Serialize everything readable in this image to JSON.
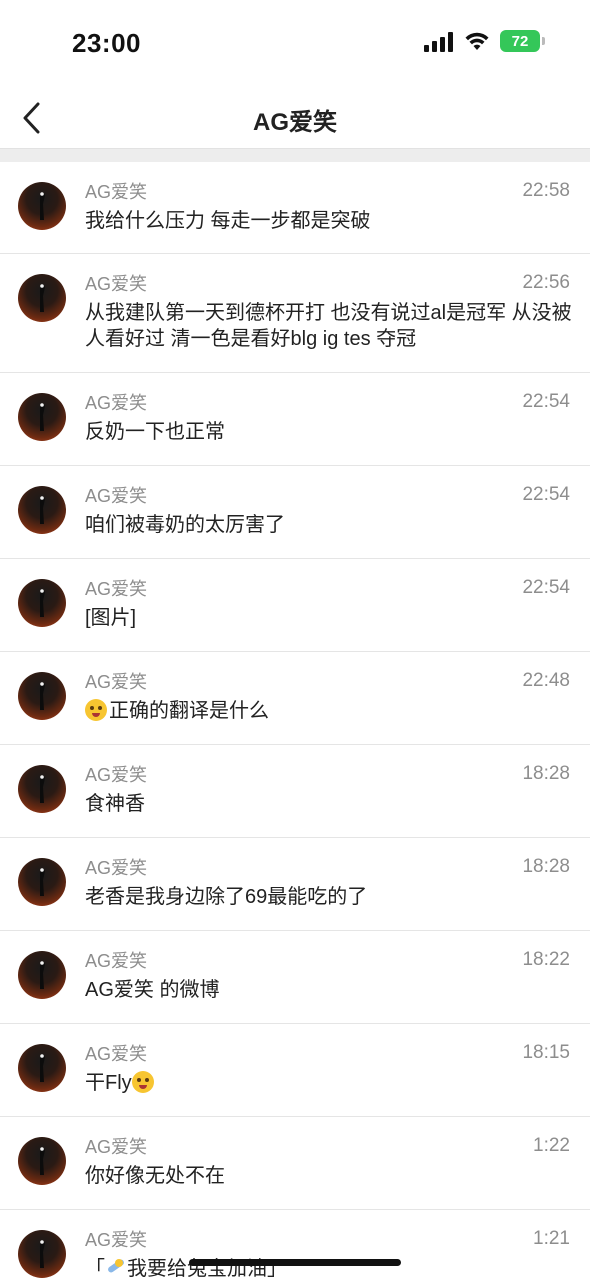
{
  "status_bar": {
    "time": "23:00",
    "battery_level": "72",
    "icons": [
      "signal-icon",
      "wifi-icon",
      "battery-icon"
    ]
  },
  "nav": {
    "title": "AG爱笑",
    "back_icon": "chevron-left-icon"
  },
  "colors": {
    "meta_gray": "#8d8d8d",
    "battery_green": "#34c759",
    "separator": "#e5e5e5"
  },
  "messages": [
    {
      "sender": "AG爱笑",
      "time": "22:58",
      "text": "我给什么压力 每走一步都是突破"
    },
    {
      "sender": "AG爱笑",
      "time": "22:56",
      "text": "从我建队第一天到德杯开打 也没有说过al是冠军 从没被人看好过 清一色是看好blg ig tes 夺冠"
    },
    {
      "sender": "AG爱笑",
      "time": "22:54",
      "text": "反奶一下也正常"
    },
    {
      "sender": "AG爱笑",
      "time": "22:54",
      "text": "咱们被毒奶的太厉害了"
    },
    {
      "sender": "AG爱笑",
      "time": "22:54",
      "text": "[图片]"
    },
    {
      "sender": "AG爱笑",
      "time": "22:48",
      "text": "正确的翻译是什么",
      "emoji_before": "sweat-smile-emoji"
    },
    {
      "sender": "AG爱笑",
      "time": "18:28",
      "text": "食神香"
    },
    {
      "sender": "AG爱笑",
      "time": "18:28",
      "text": "老香是我身边除了69最能吃的了"
    },
    {
      "sender": "AG爱笑",
      "time": "18:22",
      "text": "AG爱笑 的微博"
    },
    {
      "sender": "AG爱笑",
      "time": "18:15",
      "text": "干Fly",
      "emoji_after": "crying-emoji"
    },
    {
      "sender": "AG爱笑",
      "time": "1:22",
      "text": "你好像无处不在"
    },
    {
      "sender": "AG爱笑",
      "time": "1:21",
      "text_prefix": "「",
      "text": "我要给兔宝加油」",
      "emoji_before": "rocket-emoji"
    }
  ]
}
